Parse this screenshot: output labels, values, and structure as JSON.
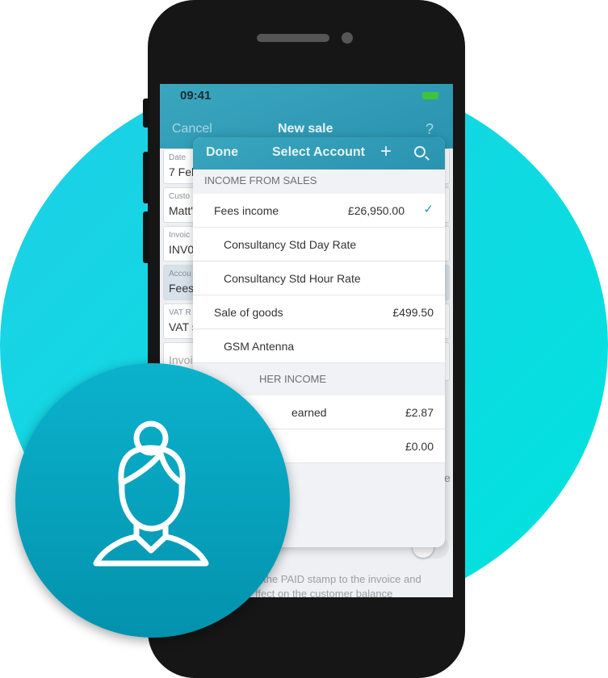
{
  "colors": {
    "brand_teal": "#2a93b0",
    "background_circle": "#1fcfe6",
    "avatar_circle": "#0aa6c2",
    "check": "#2a93b0"
  },
  "status_bar": {
    "time": "09:41",
    "battery_icon": "battery-charging-icon"
  },
  "nav": {
    "cancel": "Cancel",
    "title": "New sale",
    "help": "?"
  },
  "form": [
    {
      "label": "Date",
      "value": "7 Feb"
    },
    {
      "label": "Custo",
      "value": "Matt'"
    },
    {
      "label": "Invoic",
      "value": "INV0"
    },
    {
      "label": "Accou",
      "value": "Fees"
    },
    {
      "label": "VAT R",
      "value": "VAT s"
    },
    {
      "label": "",
      "value": "Invoi"
    }
  ],
  "footnote": {
    "line1": "s the PAID stamp to the invoice and",
    "line2": "ffect on the customer balance"
  },
  "edge_letter": "e",
  "modal": {
    "done": "Done",
    "title": "Select Account",
    "plus": "+",
    "sections": [
      {
        "header": "INCOME FROM SALES",
        "rows": [
          {
            "name": "Fees income",
            "amount": "£26,950.00",
            "check": "✓"
          },
          {
            "name": "Consultancy Std Day Rate",
            "amount": ""
          },
          {
            "name": "Consultancy Std Hour Rate",
            "amount": ""
          },
          {
            "name": "Sale of goods",
            "amount": "£499.50"
          },
          {
            "name": "GSM Antenna",
            "amount": ""
          }
        ]
      },
      {
        "header": "HER INCOME",
        "rows": [
          {
            "name": "earned",
            "amount": "£2.87"
          },
          {
            "name": "e",
            "amount": "£0.00"
          }
        ]
      }
    ]
  }
}
